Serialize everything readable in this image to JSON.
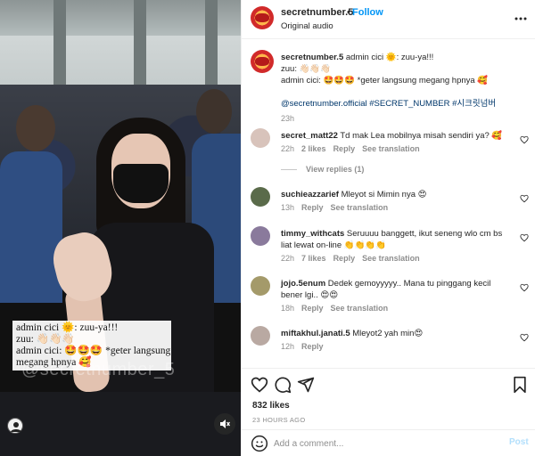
{
  "video": {
    "caption_lines": [
      "admin cici 🌞: zuu-ya!!!",
      "zuu: 👋🏻👋🏻👋🏻",
      "admin cici: 🤩🤩🤩 *geter langsung",
      "megang hpnya 🥰"
    ],
    "watermark": "@secretnumber_5"
  },
  "header": {
    "username": "secretnumber.5",
    "separator": "•",
    "follow_label": "Follow",
    "audio": "Original audio"
  },
  "caption": {
    "username": "secretnumber.5",
    "line1": " admin cici 🌞: zuu-ya!!!",
    "line2": "zuu: 👋🏻👋🏻👋🏻",
    "line3": "admin cici: 🤩🤩🤩 *geter langsung megang hpnya 🥰",
    "tags": "@secretnumber.official #SECRET_NUMBER #시크릿넘버",
    "time": "23h"
  },
  "comments": [
    {
      "user": "secret_matt22",
      "text": "Td mak Lea mobilnya misah sendiri ya? 🥰",
      "time": "22h",
      "likes": "2 likes",
      "reply": "Reply",
      "translate": "See translation",
      "avatar_color": "#d8c3bb"
    },
    {
      "user": "suchieazzarief",
      "text": "Mleyot si Mimin nya 😍",
      "time": "13h",
      "likes": "",
      "reply": "Reply",
      "translate": "See translation",
      "avatar_color": "#5a6b4a"
    },
    {
      "user": "timmy_withcats",
      "text": "Seruuuu banggett, ikut seneng wlo cm bs liat lewat on-line 👏👏👏👏",
      "time": "22h",
      "likes": "7 likes",
      "reply": "Reply",
      "translate": "See translation",
      "avatar_color": "#8a7a9c"
    },
    {
      "user": "jojo.5enum",
      "text": "Dedek gemoyyyyy.. Mana tu pinggang kecil bener lgi.. 😍😍",
      "time": "18h",
      "likes": "",
      "reply": "Reply",
      "translate": "See translation",
      "avatar_color": "#a49a6a"
    },
    {
      "user": "miftakhul.janati.5",
      "text": "Mleyot2 yah min😍",
      "time": "12h",
      "likes": "",
      "reply": "Reply",
      "translate": "",
      "avatar_color": "#b9a9a2"
    }
  ],
  "view_replies": "View replies (1)",
  "actions": {
    "likes": "832 likes",
    "time": "23 HOURS AGO"
  },
  "add_comment": {
    "placeholder": "Add a comment...",
    "post_label": "Post"
  },
  "colors": {
    "link_blue": "#0095f6",
    "muted": "#8e8e8e",
    "post_disabled": "#b2dffc"
  },
  "icons": [
    "heart-icon",
    "comment-icon",
    "share-icon",
    "bookmark-icon",
    "more-icon",
    "mute-icon",
    "emoji-icon"
  ]
}
